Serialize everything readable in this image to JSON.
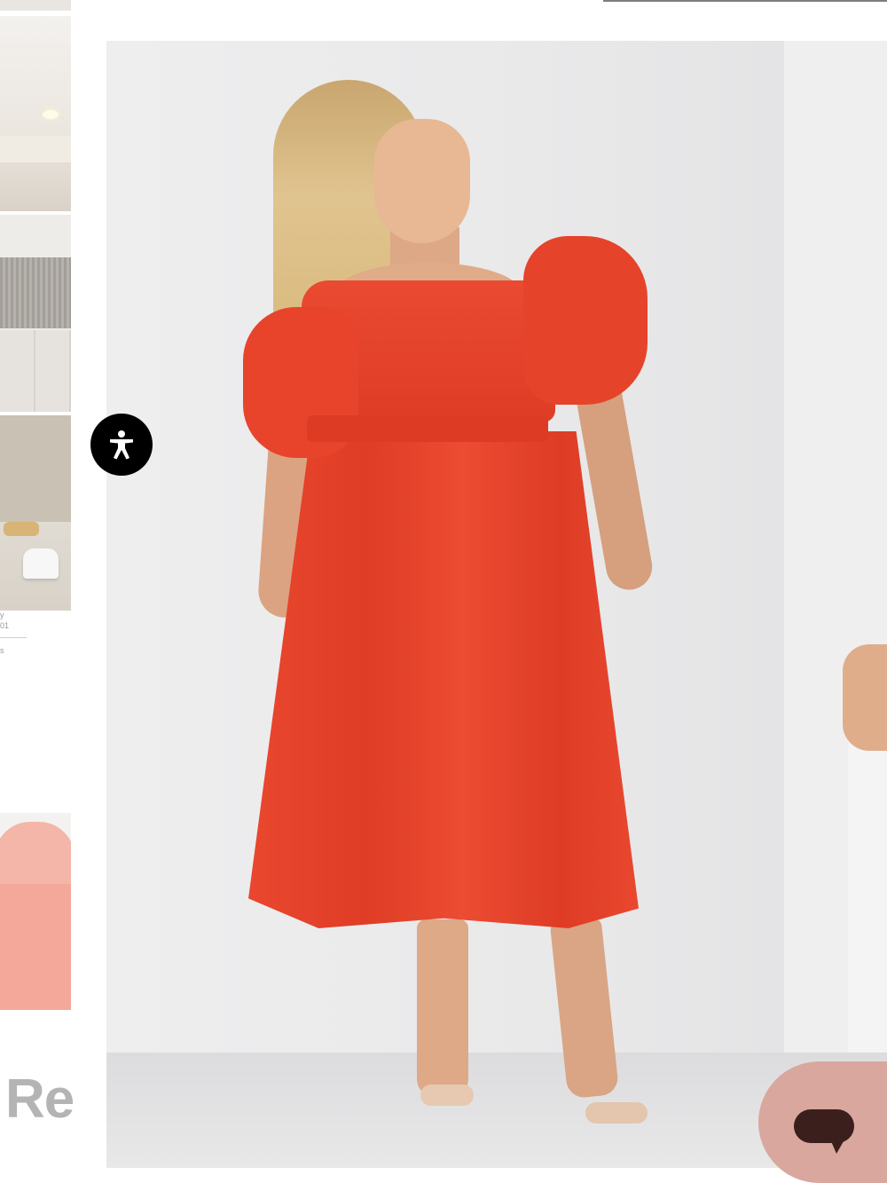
{
  "left_strip": {
    "captions": [
      "y",
      "01",
      "s"
    ],
    "heading_fragment": "Re"
  },
  "main_image": {
    "alt_text": ""
  },
  "accessibility_button": {
    "icon": "accessibility-person-icon",
    "colors": {
      "background": "#000000",
      "icon": "#ffffff"
    }
  },
  "chat_button": {
    "icon": "chat-bubble-icon",
    "colors": {
      "background": "#d9a79e",
      "icon": "#3b1f1c"
    }
  },
  "colors": {
    "dress": "#e6432b",
    "backdrop": "#e8e8e9"
  }
}
